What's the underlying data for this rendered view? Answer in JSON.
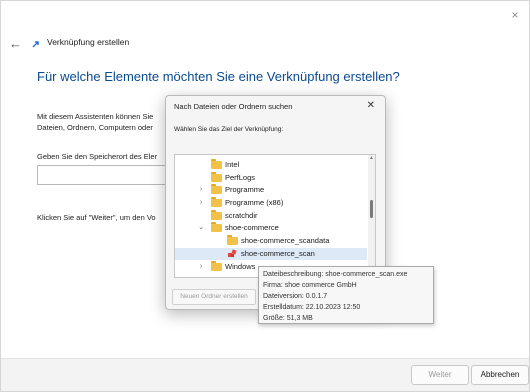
{
  "wizard": {
    "title": "Verknüpfung erstellen",
    "heading": "Für welche Elemente möchten Sie eine Verknüpfung erstellen?",
    "intro_line1": "Mit diesem Assistenten können Sie",
    "intro_line2": "Dateien, Ordnern, Computern oder",
    "location_label": "Geben Sie den Speicherort des Eler",
    "location_value": "",
    "continue_hint": "Klicken Sie auf \"Weiter\", um den Vo",
    "next_label": "Weiter",
    "cancel_label": "Abbrechen",
    "close_glyph": "×",
    "back_glyph": "←"
  },
  "browse_dialog": {
    "title": "Nach Dateien oder Ordnern suchen",
    "close_glyph": "✕",
    "prompt": "Wählen Sie das Ziel der Verknüpfung:",
    "new_folder_label": "Neuen Ordner erstellen",
    "tree": [
      {
        "label": "Intel",
        "icon": "folder-icon",
        "expander": "",
        "selected": false
      },
      {
        "label": "PerfLogs",
        "icon": "folder-icon",
        "expander": "",
        "selected": false
      },
      {
        "label": "Programme",
        "icon": "folder-icon",
        "expander": ">",
        "selected": false
      },
      {
        "label": "Programme (x86)",
        "icon": "folder-icon",
        "expander": ">",
        "selected": false
      },
      {
        "label": "scratchdir",
        "icon": "folder-icon",
        "expander": "",
        "selected": false
      },
      {
        "label": "shoe-commerce",
        "icon": "folder-icon",
        "expander": "v",
        "selected": false
      },
      {
        "label": "shoe-commerce_scandata",
        "icon": "folder-icon",
        "expander": "",
        "selected": false
      },
      {
        "label": "shoe-commerce_scan",
        "icon": "exe-icon",
        "expander": "",
        "selected": true
      },
      {
        "label": "Windows",
        "icon": "folder-icon",
        "expander": ">",
        "selected": false
      }
    ]
  },
  "tooltip": {
    "description": "Dateibeschreibung: shoe-commerce_scan.exe",
    "company": "Firma: shoe commerce GmbH",
    "version": "Dateiversion: 0.0.1.7",
    "created": "Erstelldatum: 22.10.2023 12:50",
    "size": "Größe: 51,3 MB"
  },
  "colors": {
    "heading": "#0b4a8f",
    "folder": "#f2c14a",
    "selection": "#dde9f7"
  }
}
